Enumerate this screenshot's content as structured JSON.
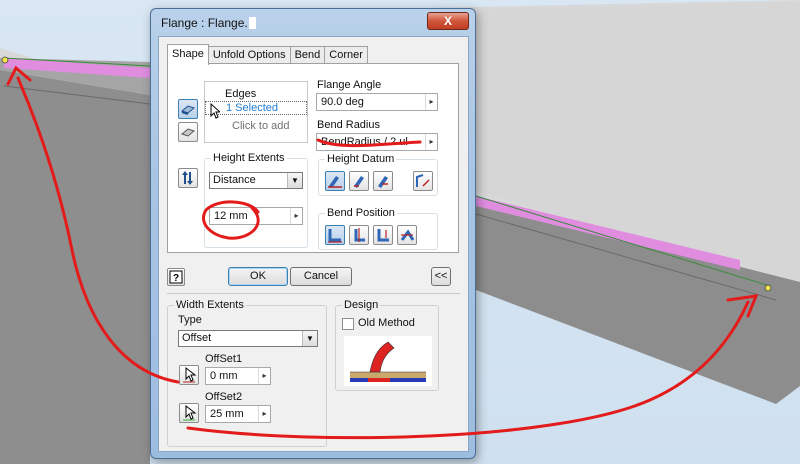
{
  "dialog": {
    "title": "Flange : Flange.",
    "close_label": "X",
    "tabs": [
      "Shape",
      "Unfold Options",
      "Bend",
      "Corner"
    ],
    "active_tab": "Shape",
    "edges": {
      "header": "Edges",
      "selected": "1 Selected",
      "add_hint": "Click to add"
    },
    "flange_angle": {
      "label": "Flange Angle",
      "value": "90.0 deg"
    },
    "bend_radius": {
      "label": "Bend Radius",
      "value": "BendRadius / 2 ul"
    },
    "height_extents": {
      "label": "Height Extents",
      "type_value": "Distance",
      "value": "12 mm"
    },
    "height_datum": {
      "label": "Height Datum"
    },
    "bend_position": {
      "label": "Bend Position"
    },
    "buttons": {
      "ok": "OK",
      "cancel": "Cancel",
      "more": "<<",
      "help": "?"
    },
    "width_extents": {
      "label": "Width Extents",
      "type_label": "Type",
      "type_value": "Offset",
      "offset1": {
        "label": "OffSet1",
        "value": "0 mm"
      },
      "offset2": {
        "label": "OffSet2",
        "value": "25 mm"
      }
    },
    "design": {
      "label": "Design",
      "old_method": "Old Method",
      "old_method_checked": false
    }
  },
  "colors": {
    "annotation": "#e31b1b",
    "edge_highlight": "#e08de0",
    "part_top": "#d6d6d6",
    "part_face": "#8f8f8f",
    "accent_blue": "#1f7bd0"
  }
}
